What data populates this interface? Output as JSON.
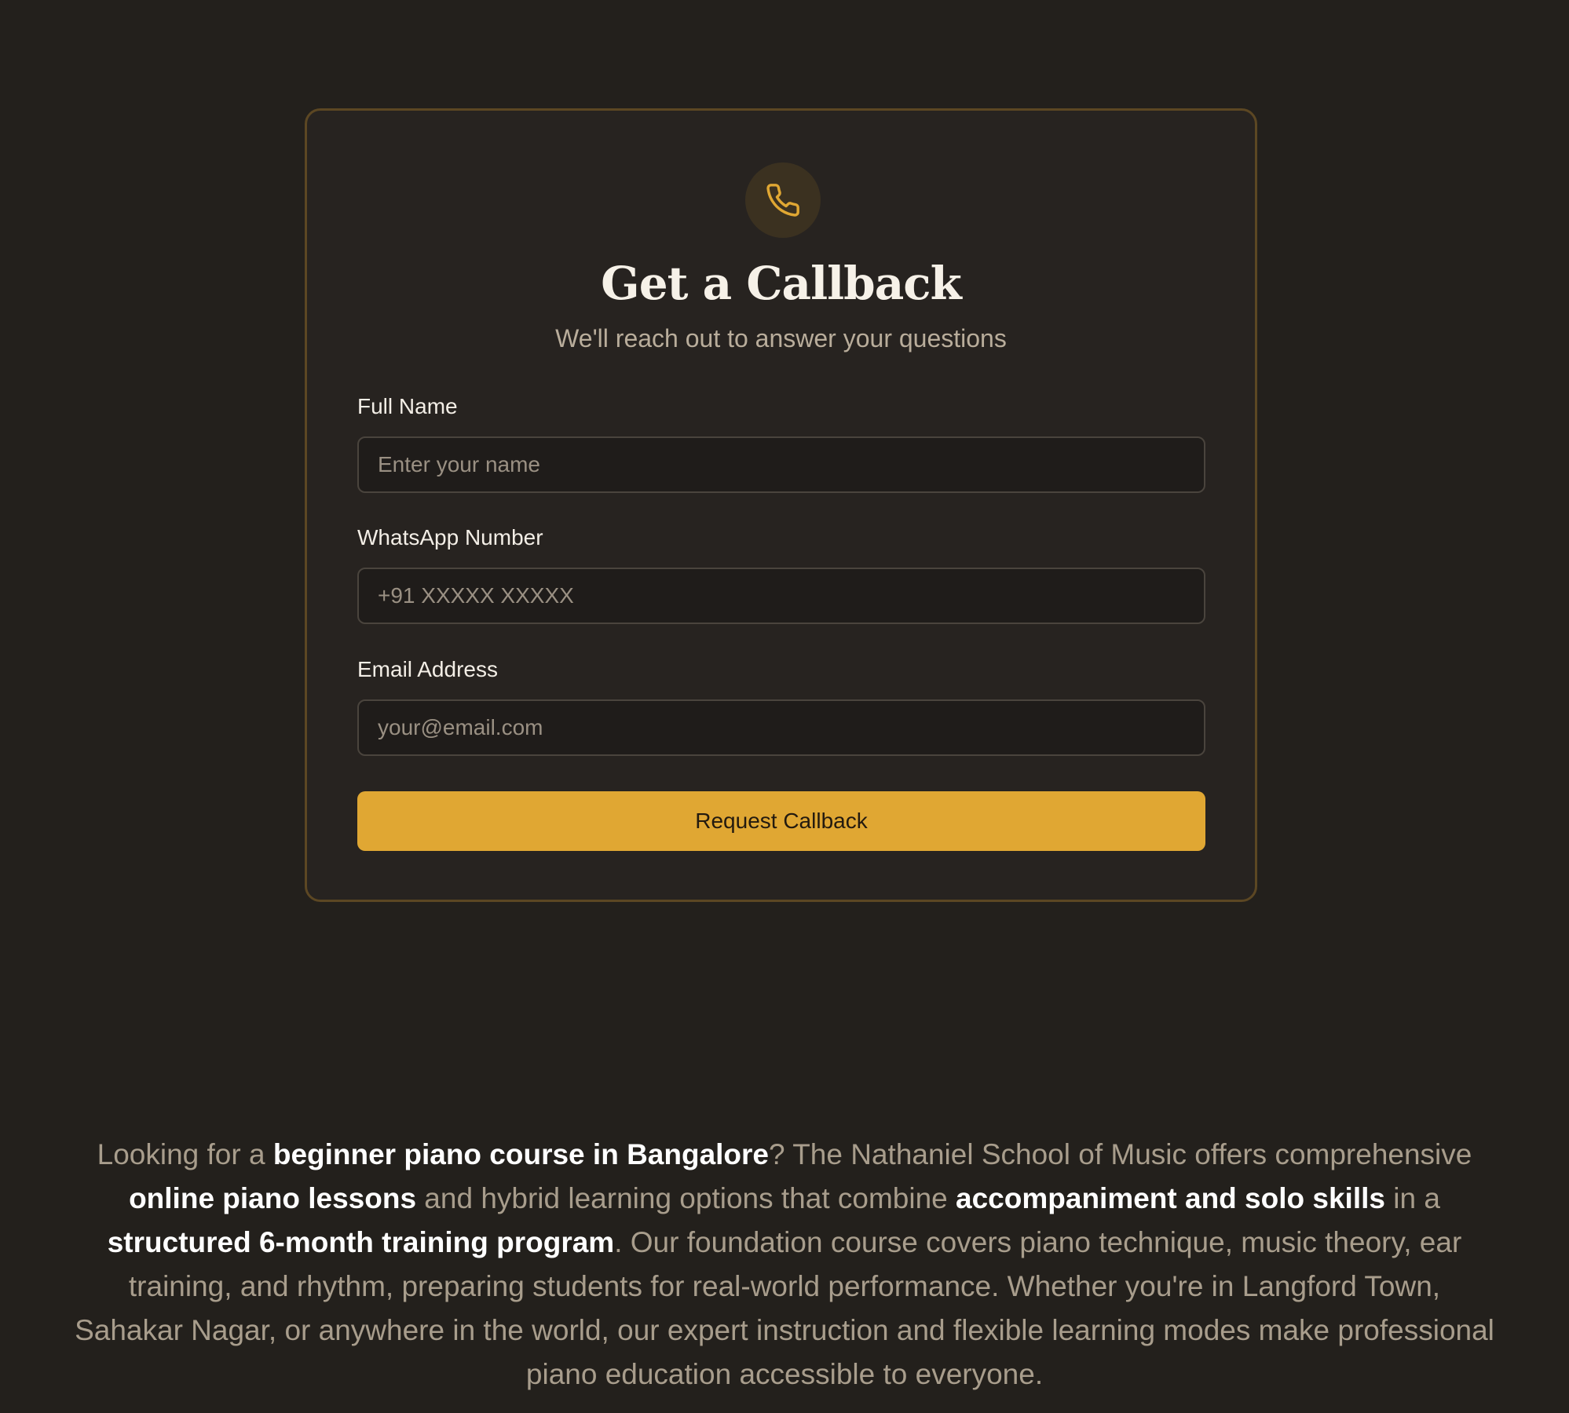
{
  "callback_form": {
    "icon": "phone-icon",
    "accent_color": "#e0a733",
    "title": "Get a Callback",
    "subtitle": "We'll reach out to answer your questions",
    "fields": [
      {
        "label": "Full Name",
        "placeholder": "Enter your name",
        "value": ""
      },
      {
        "label": "WhatsApp Number",
        "placeholder": "+91 XXXXX XXXXX",
        "value": ""
      },
      {
        "label": "Email Address",
        "placeholder": "your@email.com",
        "value": ""
      }
    ],
    "submit_label": "Request Callback"
  },
  "seo_paragraph": {
    "segments": [
      {
        "text": "Looking for a ",
        "bold": false
      },
      {
        "text": "beginner piano course in Bangalore",
        "bold": true
      },
      {
        "text": "? The Nathaniel School of Music offers comprehensive ",
        "bold": false
      },
      {
        "text": "online piano lessons",
        "bold": true
      },
      {
        "text": " and hybrid learning options that combine ",
        "bold": false
      },
      {
        "text": "accompaniment and solo skills",
        "bold": true
      },
      {
        "text": " in a ",
        "bold": false
      },
      {
        "text": "structured 6-month training program",
        "bold": true
      },
      {
        "text": ". Our foundation course covers piano technique, music theory, ear training, and rhythm, preparing students for real-world performance. Whether you're in Langford Town, Sahakar Nagar, or anywhere in the world, our expert instruction and flexible learning modes make professional piano education accessible to everyone.",
        "bold": false
      }
    ]
  }
}
